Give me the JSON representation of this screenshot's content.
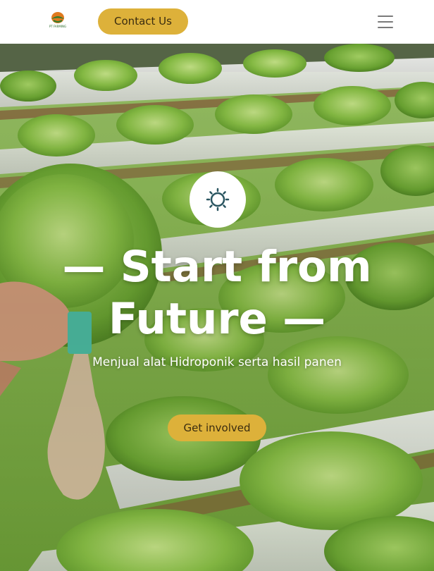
{
  "nav": {
    "logo_text": "PT FARMING",
    "contact_label": "Contact Us",
    "menu_icon": "hamburger-menu-icon"
  },
  "hero": {
    "icon": "sun-icon",
    "headline_line1": "— Start from",
    "headline_line2": "Future —",
    "subtitle": "Menjual alat Hidroponik serta hasil panen",
    "cta_label": "Get involved"
  },
  "colors": {
    "accent": "#ddb13a",
    "foliage": "#7fb83a",
    "pipe": "#eeeeee"
  }
}
